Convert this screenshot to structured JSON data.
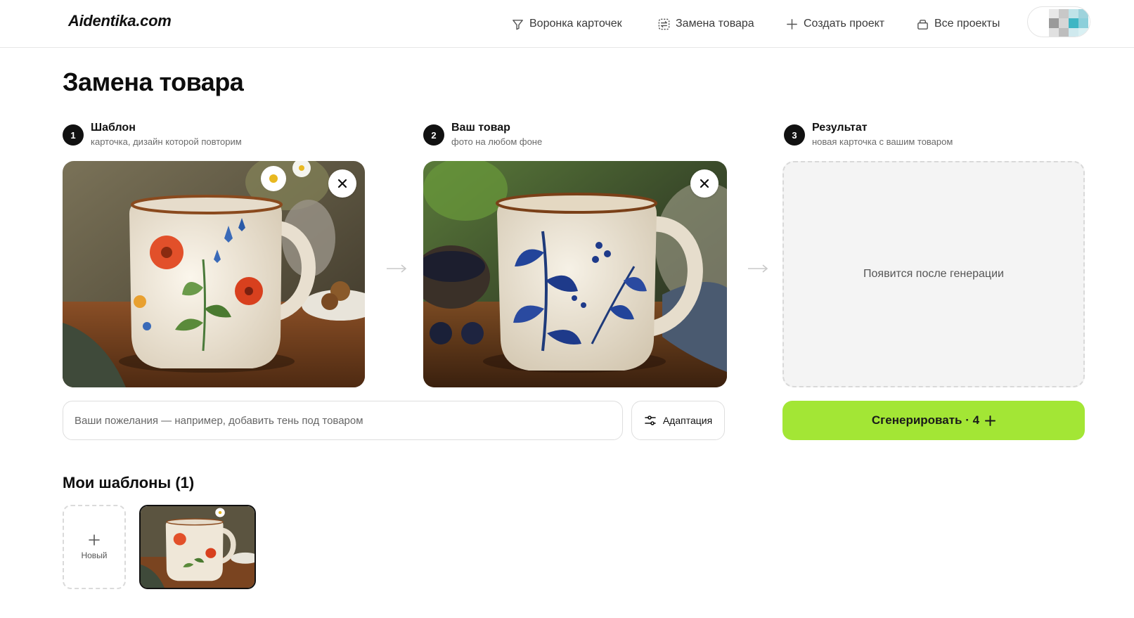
{
  "header": {
    "logo": "Aidentika.com",
    "nav": [
      {
        "label": "Воронка карточек",
        "icon": "funnel-icon"
      },
      {
        "label": "Замена товара",
        "icon": "swap-icon"
      },
      {
        "label": "Создать проект",
        "icon": "plus-icon"
      },
      {
        "label": "Все проекты",
        "icon": "folder-icon"
      }
    ],
    "avatar_icon": "pixel-avatar-icon"
  },
  "page": {
    "title": "Замена товара"
  },
  "steps": [
    {
      "num": "1",
      "title": "Шаблон",
      "subtitle": "карточка, дизайн которой повторим"
    },
    {
      "num": "2",
      "title": "Ваш товар",
      "subtitle": "фото на любом фоне"
    },
    {
      "num": "3",
      "title": "Результат",
      "subtitle": "новая карточка с вашим товаром"
    }
  ],
  "result": {
    "placeholder": "Появится после генерации"
  },
  "controls": {
    "wish_placeholder": "Ваши пожелания — например, добавить тень под товаром",
    "adapt_label": "Адаптация",
    "generate_label": "Сгенерировать · 4"
  },
  "templates": {
    "title": "Мои шаблоны (1)",
    "new_label": "Новый"
  },
  "colors": {
    "accent": "#a3e635",
    "text": "#111111"
  }
}
